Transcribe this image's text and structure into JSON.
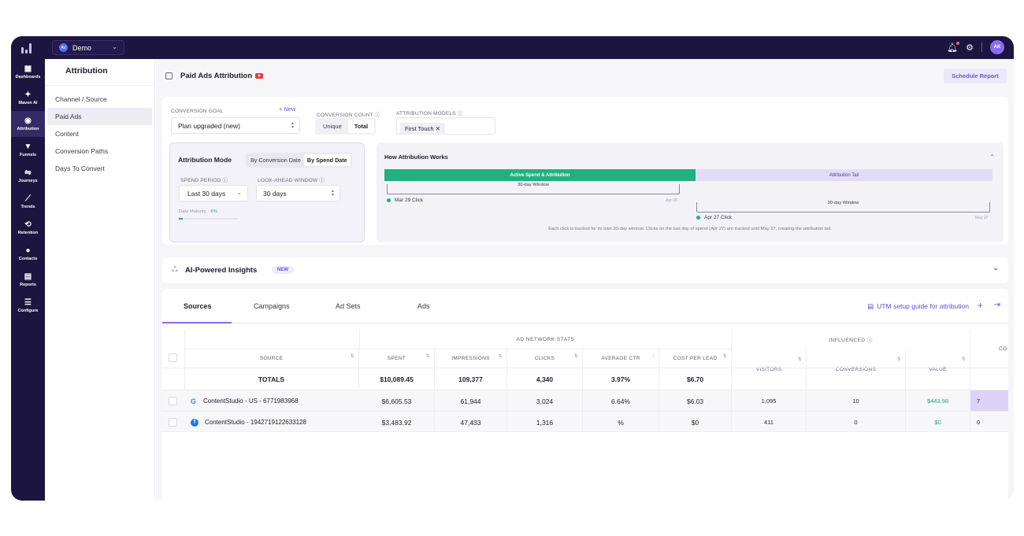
{
  "workspace": {
    "name": "Demo",
    "avatar": "AV"
  },
  "user": {
    "initials": "AK"
  },
  "rail": [
    {
      "label": "Dashboards",
      "glyph": "▦"
    },
    {
      "label": "Maven AI",
      "glyph": "✦"
    },
    {
      "label": "Attribution",
      "glyph": "◉"
    },
    {
      "label": "Funnels",
      "glyph": "▼"
    },
    {
      "label": "Journeys",
      "glyph": "⇋"
    },
    {
      "label": "Trends",
      "glyph": "⟋"
    },
    {
      "label": "Retention",
      "glyph": "⟲"
    },
    {
      "label": "Contacts",
      "glyph": "●"
    },
    {
      "label": "Reports",
      "glyph": "▤"
    },
    {
      "label": "Configure",
      "glyph": "☰"
    }
  ],
  "subnav": {
    "title": "Attribution",
    "items": [
      "Channel / Source",
      "Paid Ads",
      "Content",
      "Conversion Paths",
      "Days To Convert"
    ]
  },
  "header": {
    "title": "Paid Ads Attribution",
    "schedule": "Schedule Report"
  },
  "config": {
    "goal_label": "CONVERSION GOAL",
    "new_link": "+ New",
    "goal_value": "Plan upgraded (new)",
    "count_label": "CONVERSION COUNT ⓘ",
    "count_opts": [
      "Unique",
      "Total"
    ],
    "models_label": "ATTRIBUTION MODELS ⓘ",
    "model_chip": "First Touch ✕",
    "mode_title": "Attribution Mode",
    "mode_opts": [
      "By Conversion Date",
      "By Spend Date"
    ],
    "spend_label": "SPEND PERIOD ⓘ",
    "spend_value": "Last 30 days",
    "look_label": "LOOK-AHEAD WINDOW ⓘ",
    "look_value": "30 days",
    "maturity_label": "Data Maturity",
    "maturity_value": "6%",
    "maturity_fraction": 0.06
  },
  "how": {
    "title": "How Attribution Works",
    "active": "Active Spend & Attribution",
    "tail": "Attribution Tail",
    "window": "30-day Window",
    "click1": "Mar 29 Click",
    "end1": "Apr 28",
    "click2": "Apr 27 Click",
    "end2": "May 27",
    "note": "Each click is tracked for its own 30-day window. Clicks on the last day of spend (Apr 27) are tracked until May 27, creating the attribution tail."
  },
  "ai": {
    "title": "AI-Powered Insights",
    "badge": "NEW"
  },
  "tabs": [
    "Sources",
    "Campaigns",
    "Ad Sets",
    "Ads"
  ],
  "utm": "UTM setup guide for attribution",
  "table": {
    "group_ad": "AD NETWORK STATS",
    "group_inf": "INFLUENCED ⓘ",
    "headers": {
      "source": "SOURCE",
      "spent": "SPENT",
      "impressions": "IMPRESSIONS",
      "clicks": "CLICKS",
      "ctr": "AVERAGE CTR",
      "cpl": "COST PER LEAD",
      "visitors": "VISITORS",
      "conversions": "CONVERSIONS",
      "value": "VALUE",
      "co": "CO"
    },
    "totals": {
      "label": "TOTALS",
      "spent": "$10,089.45",
      "impressions": "109,377",
      "clicks": "4,340",
      "ctr": "3.97%",
      "cpl": "$6.70"
    },
    "rows": [
      {
        "source": "ContentStudio - US - 6771983968",
        "spent": "$6,605.53",
        "impressions": "61,944",
        "clicks": "3,024",
        "ctr": "6.64%",
        "cpl": "$6.03",
        "visitors": "1,095",
        "conversions": "10",
        "value": "$443.98",
        "co": "7"
      },
      {
        "source": "ContentStudio - 1942719122633128",
        "spent": "$3,483.92",
        "impressions": "47,433",
        "clicks": "1,316",
        "ctr": "%",
        "cpl": "$0",
        "visitors": "411",
        "conversions": "0",
        "value": "$0",
        "co": "0"
      }
    ]
  }
}
